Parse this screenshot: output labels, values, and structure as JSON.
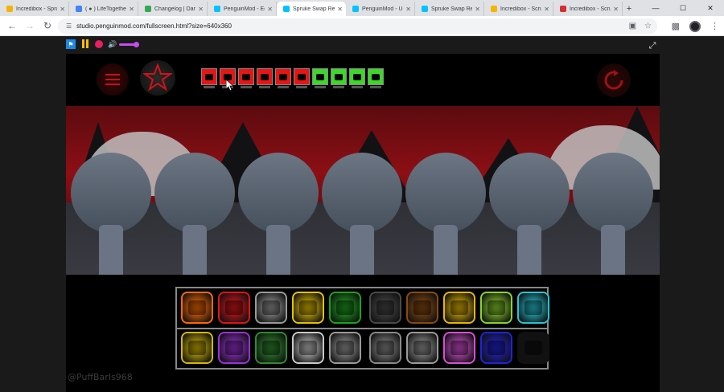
{
  "browser": {
    "tabs": [
      {
        "title": "Incredibox - Spru",
        "color": "#f4b400",
        "active": false
      },
      {
        "title": "( ● ) LifeTogether",
        "color": "#4285f4",
        "active": false
      },
      {
        "title": "Changelog | Dand",
        "color": "#34a853",
        "active": false
      },
      {
        "title": "PenguinMod - Ed",
        "color": "#00c3ff",
        "active": false
      },
      {
        "title": "Spruke Swap Rest",
        "color": "#00c3ff",
        "active": true
      },
      {
        "title": "PenguinMod - Up",
        "color": "#00c3ff",
        "active": false
      },
      {
        "title": "Spruke Swap Retr",
        "color": "#00c3ff",
        "active": false
      },
      {
        "title": "Incredibox - Scrun",
        "color": "#f4b400",
        "active": false
      },
      {
        "title": "Incredibox - Scru",
        "color": "#d32f2f",
        "active": false
      }
    ],
    "new_tab": "+",
    "window_controls": {
      "minimize": "—",
      "maximize": "☐",
      "close": "✕"
    },
    "url": "studio.penguinmod.com/fullscreen.html?size=640x360"
  },
  "player": {
    "flag_icon": "green-flag-icon",
    "pause_icon": "pause-icon",
    "stop_icon": "stop-icon",
    "volume_icon": "volume-icon",
    "volume_level": 1.0
  },
  "stage": {
    "mini_icons": [
      "red",
      "red",
      "red",
      "red",
      "red",
      "red",
      "green",
      "green",
      "green",
      "green"
    ],
    "characters": 7,
    "bottom_tiles_top": [
      {
        "icon": "headphones",
        "color": "#ff6a00"
      },
      {
        "icon": "splat",
        "color": "#e0141a"
      },
      {
        "icon": "blade",
        "color": "#9a9a9a"
      },
      {
        "icon": "tv-antenna",
        "color": "#e6c200"
      },
      {
        "icon": "frog",
        "color": "#1ca31c"
      },
      {
        "icon": "mask",
        "color": "#4a4a4a"
      },
      {
        "icon": "card",
        "color": "#8a4a10"
      },
      {
        "icon": "phone",
        "color": "#e6b800"
      },
      {
        "icon": "grass",
        "color": "#8ad32a"
      },
      {
        "icon": "bomb",
        "color": "#24c6d6"
      }
    ],
    "bottom_tiles_bottom": [
      {
        "icon": "robot",
        "color": "#d4b800"
      },
      {
        "icon": "spiky-hair",
        "color": "#9b30d8"
      },
      {
        "icon": "cloud-hair",
        "color": "#2e8b2e"
      },
      {
        "icon": "lightning",
        "color": "#c9c9c9"
      },
      {
        "icon": "straw-hat",
        "color": "#9a9a9a"
      },
      {
        "icon": "monitor",
        "color": "#8a8a8a"
      },
      {
        "icon": "claws",
        "color": "#9a9a9a"
      },
      {
        "icon": "bone",
        "color": "#d54fd5"
      },
      {
        "icon": "blue-orb",
        "color": "#2222dd"
      },
      {
        "icon": "top-hat",
        "color": "#111111"
      }
    ],
    "watermark": "@PuffBarIs968"
  }
}
